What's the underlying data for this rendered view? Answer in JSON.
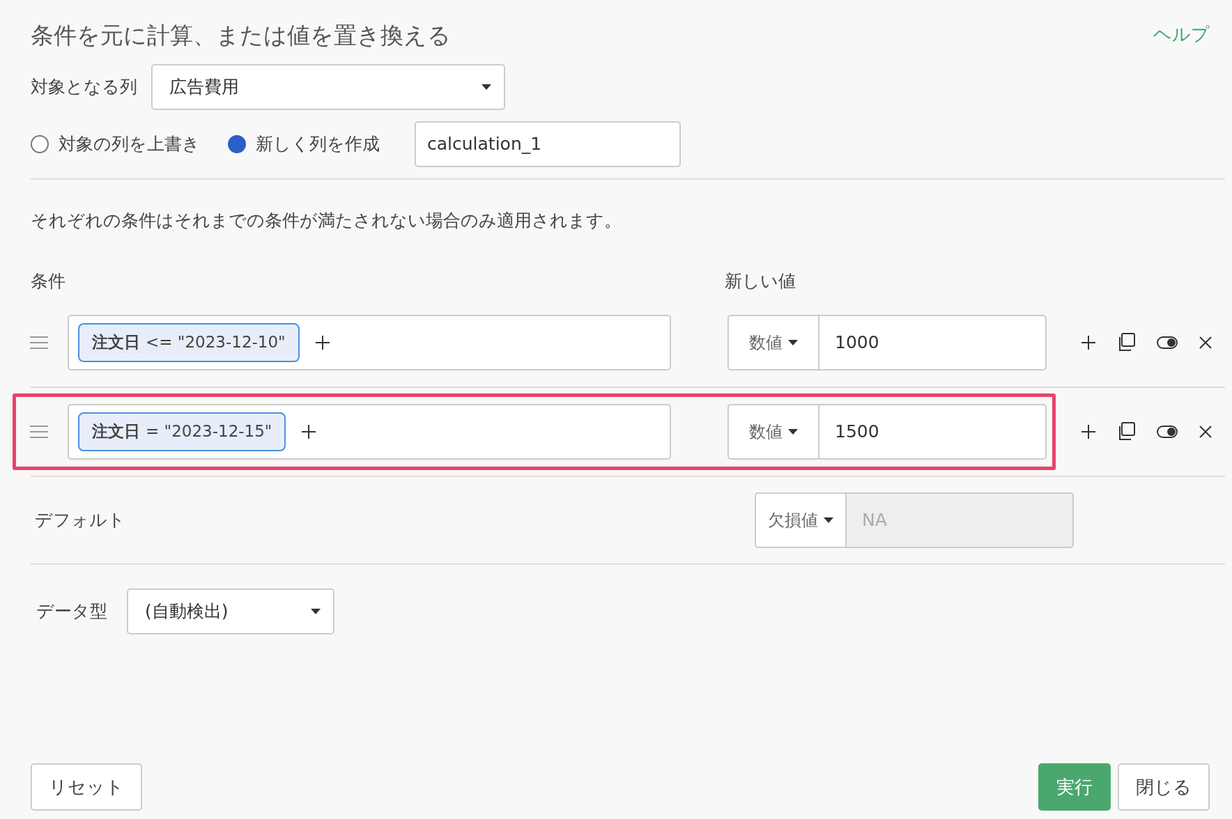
{
  "title": "条件を元に計算、または値を置き換える",
  "help_link": "ヘルプ",
  "target_column": {
    "label": "対象となる列",
    "value": "広告費用"
  },
  "output_mode": [
    {
      "label": "対象の列を上書き",
      "selected": false
    },
    {
      "label": "新しく列を作成",
      "selected": true
    }
  ],
  "new_column_name": {
    "value": "calculation_1"
  },
  "note": "それぞれの条件はそれまでの条件が満たされない場合のみ適用されます。",
  "headers": {
    "condition": "条件",
    "new_value": "新しい値"
  },
  "rules": [
    {
      "condition": {
        "column": "注文日",
        "operator": "<=",
        "value": "\"2023-12-10\""
      },
      "value_type": "数値",
      "value": "1000",
      "highlighted": false
    },
    {
      "condition": {
        "column": "注文日",
        "operator": "=",
        "value": "\"2023-12-15\""
      },
      "value_type": "数値",
      "value": "1500",
      "highlighted": true
    }
  ],
  "default": {
    "label": "デフォルト",
    "value_type": "欠損値",
    "value": "NA",
    "disabled": true
  },
  "data_type": {
    "label": "データ型",
    "value": "(自動検出)"
  },
  "buttons": {
    "reset": "リセット",
    "run": "実行",
    "close": "閉じる"
  }
}
